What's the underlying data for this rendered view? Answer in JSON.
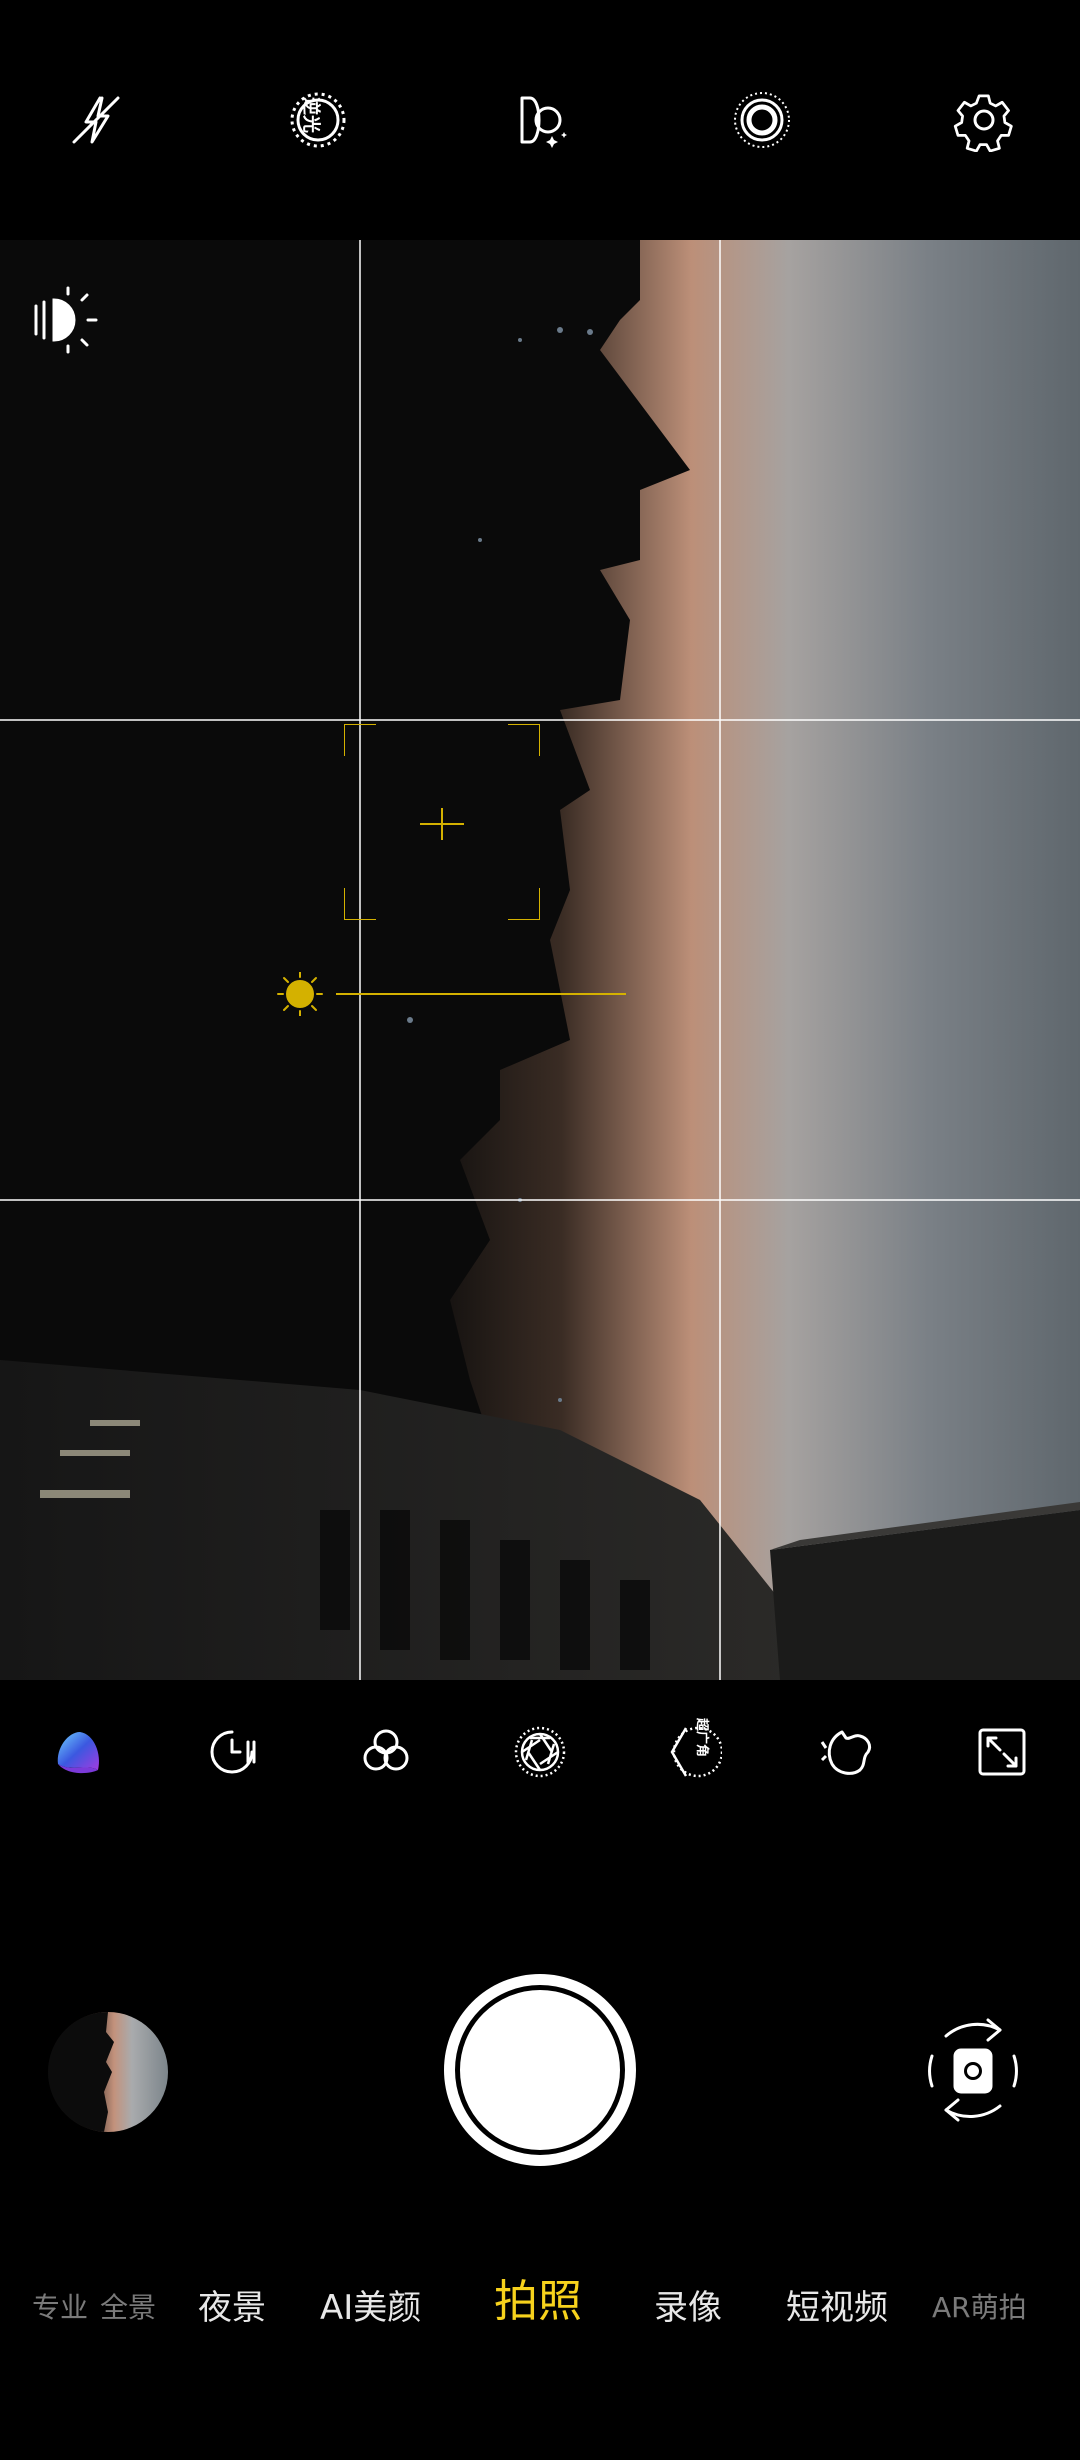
{
  "top_bar": {
    "icons": [
      "flash-off-icon",
      "backlight-hdr-icon",
      "ai-scene-icon",
      "live-photo-icon",
      "settings-icon"
    ],
    "hdr_label": "逆光"
  },
  "viewfinder": {
    "grid": "3x3",
    "focus_color": "#d4b100",
    "exposure_level": 0.5
  },
  "tools": {
    "icons": [
      "ai-color-icon",
      "timer-icon",
      "filter-icon",
      "aperture-icon",
      "ultra-wide-icon",
      "beauty-icon",
      "expand-icon"
    ],
    "ultra_wide_label": "超广角"
  },
  "controls": {
    "gallery": "gallery-thumbnail",
    "shutter": "shutter-button",
    "switch": "switch-camera"
  },
  "modes": {
    "items": [
      {
        "label": "专业",
        "state": "fade"
      },
      {
        "label": "全景",
        "state": "fade"
      },
      {
        "label": "夜景",
        "state": "normal"
      },
      {
        "label": "AI美颜",
        "state": "normal"
      },
      {
        "label": "拍照",
        "state": "active"
      },
      {
        "label": "录像",
        "state": "normal"
      },
      {
        "label": "短视频",
        "state": "normal"
      },
      {
        "label": "AR萌拍",
        "state": "fade"
      }
    ]
  },
  "colors": {
    "accent": "#f7d21c",
    "background": "#000000"
  }
}
